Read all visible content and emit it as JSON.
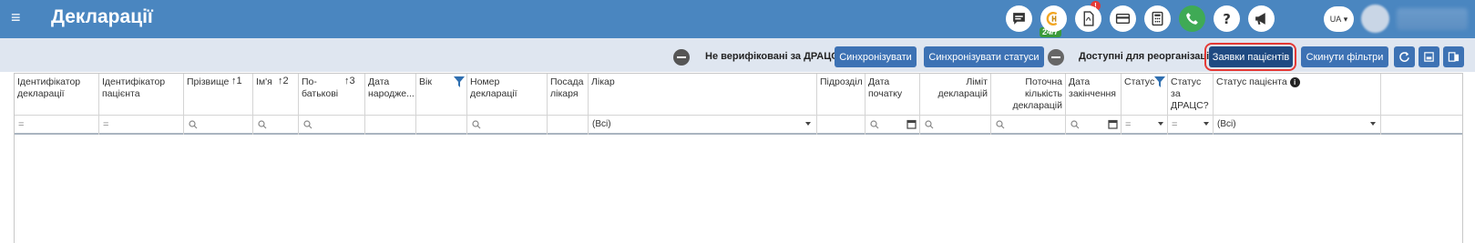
{
  "header": {
    "title": "Декларації",
    "badge_247": "24/7",
    "alert_count": "!",
    "language": "UA"
  },
  "toolbar": {
    "unverified_label": "Не верифіковані за ДРАЦС",
    "sync_label": "Синхронізувати",
    "sync_status_label": "Синхронізувати статуси",
    "reorg_label": "Доступні для реорганізаці",
    "patient_requests_label": "Заявки пацієнтів",
    "reset_filters_label": "Скинути фільтри"
  },
  "columns": [
    {
      "label": "Ідентифікатор декларації",
      "filter": "="
    },
    {
      "label": "Ідентифікатор пацієнта",
      "filter": "="
    },
    {
      "label": "Прізвище",
      "sort": "1",
      "filter": ""
    },
    {
      "label": "Ім'я",
      "sort": "2",
      "filter": ""
    },
    {
      "label": "По-батькові",
      "sort": "3",
      "filter": ""
    },
    {
      "label": "Дата народже...",
      "filter": ""
    },
    {
      "label": "Вік",
      "filter": ""
    },
    {
      "label": "Номер декларації",
      "filter": ""
    },
    {
      "label": "Посада лікаря",
      "filter": ""
    },
    {
      "label": "Лікар",
      "filter": "(Всі)"
    },
    {
      "label": "Підрозділ",
      "filter": ""
    },
    {
      "label": "Дата початку",
      "filter": ""
    },
    {
      "label": "Ліміт декларацій",
      "filter": ""
    },
    {
      "label": "Поточна кількість декларацій",
      "filter": ""
    },
    {
      "label": "Дата закінчення",
      "filter": ""
    },
    {
      "label": "Статус",
      "filter": "="
    },
    {
      "label": "Статус за ДРАЦС?",
      "filter": "="
    },
    {
      "label": "Статус пацієнта",
      "filter": "(Всі)"
    }
  ],
  "colors": {
    "topbar": "#4a86c0",
    "button": "#3d72b4",
    "highlight": "#e53935"
  }
}
